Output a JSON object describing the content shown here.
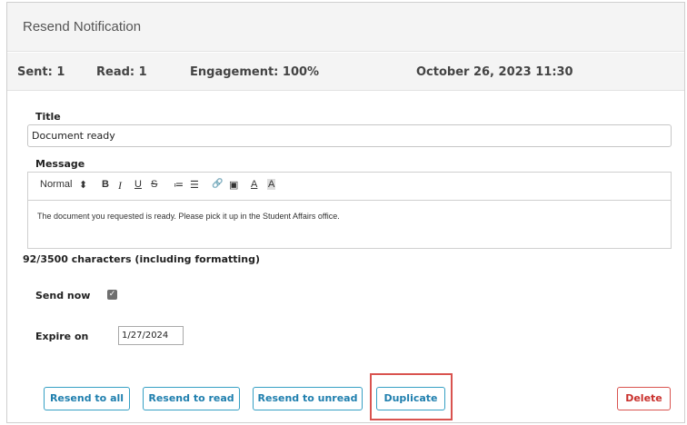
{
  "header": {
    "title": "Resend Notification"
  },
  "stats": {
    "sent": "Sent: 1",
    "read": "Read: 1",
    "engagement": "Engagement: 100%",
    "timestamp": "October 26, 2023 11:30"
  },
  "form": {
    "title_label": "Title",
    "title_value": "Document ready",
    "message_label": "Message",
    "toolbar": {
      "format": "Normal",
      "format_arrows": "⬍",
      "bold": "B",
      "italic": "I",
      "underline": "U",
      "strike": "S",
      "ordered_list": "≔",
      "bullet_list": "☰",
      "link": "🔗",
      "image": "▣",
      "font_color": "A",
      "background_color": "A"
    },
    "message_text": "The document you requested is ready. Please pick it up in the Student Affairs office.",
    "char_counter": "92/3500 characters (including formatting)",
    "send_now_label": "Send now",
    "send_now_checked": true,
    "expire_label": "Expire on",
    "expire_value": "1/27/2024"
  },
  "actions": {
    "resend_all": "Resend to all",
    "resend_read": "Resend to read",
    "resend_unread": "Resend to unread",
    "duplicate": "Duplicate",
    "delete": "Delete"
  },
  "colors": {
    "primary": "#1f7fae",
    "danger": "#d9534f",
    "header_bg": "#f4f4f4"
  }
}
